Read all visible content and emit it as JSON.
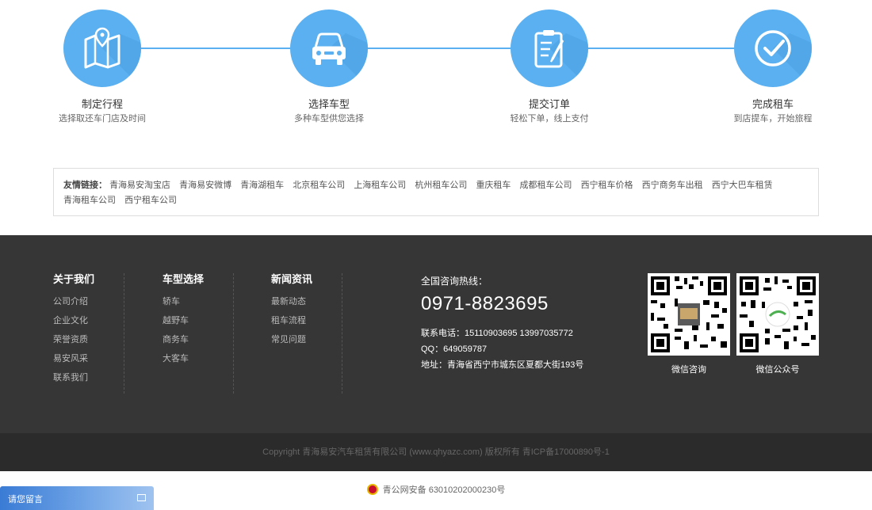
{
  "steps": [
    {
      "title": "制定行程",
      "desc": "选择取还车门店及时间",
      "icon": "map-icon"
    },
    {
      "title": "选择车型",
      "desc": "多种车型供您选择",
      "icon": "car-icon"
    },
    {
      "title": "提交订单",
      "desc": "轻松下单，线上支付",
      "icon": "clipboard-icon"
    },
    {
      "title": "完成租车",
      "desc": "到店提车，开始旅程",
      "icon": "check-circle-icon"
    }
  ],
  "links": {
    "label": "友情链接：",
    "items": [
      "青海易安淘宝店",
      "青海易安微博",
      "青海湖租车",
      "北京租车公司",
      "上海租车公司",
      "杭州租车公司",
      "重庆租车",
      "成都租车公司",
      "西宁租车价格",
      "西宁商务车出租",
      "西宁大巴车租赁",
      "青海租车公司",
      "西宁租车公司"
    ]
  },
  "footer": {
    "about": {
      "title": "关于我们",
      "items": [
        "公司介绍",
        "企业文化",
        "荣誉资质",
        "易安风采",
        "联系我们"
      ]
    },
    "models": {
      "title": "车型选择",
      "items": [
        "轿车",
        "越野车",
        "商务车",
        "大客车"
      ]
    },
    "news": {
      "title": "新闻资讯",
      "items": [
        "最新动态",
        "租车流程",
        "常见问题"
      ]
    },
    "contact": {
      "title": "全国咨询热线：",
      "hotline": "0971-8823695",
      "phone": "联系电话：15110903695   13997035772",
      "qq": "QQ：649059787",
      "address": "地址：青海省西宁市城东区夏都大街193号"
    },
    "qr": [
      {
        "caption": "微信咨询"
      },
      {
        "caption": "微信公众号"
      }
    ]
  },
  "copyright": "Copyright 青海易安汽车租赁有限公司 (www.qhyazc.com) 版权所有  青ICP备17000890号-1",
  "beian": "青公网安备 63010202000230号",
  "message_widget": {
    "title": "请您留言"
  },
  "colors": {
    "accent": "#5ab0f0",
    "footer_bg": "#363636",
    "copyright_bg": "#2b2b2b"
  }
}
